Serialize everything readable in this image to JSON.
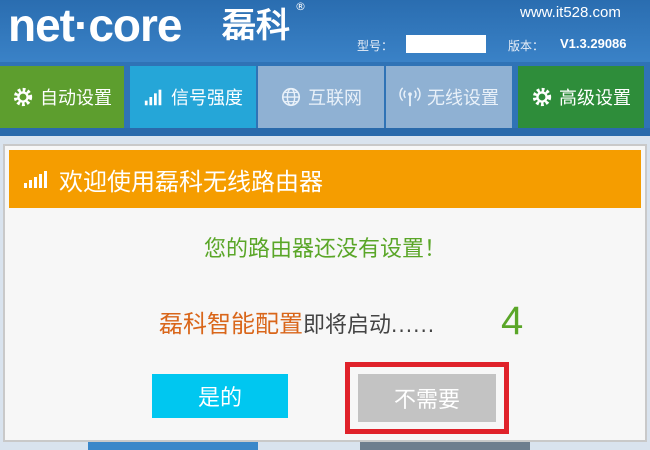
{
  "header": {
    "logo_text": "net·core",
    "logo_cn": "磊科",
    "registered_mark": "®",
    "watermark": "www.it528.com",
    "model_label": "型号：",
    "version_label": "版本：",
    "version_value": "V1.3.29086"
  },
  "nav": {
    "tabs": [
      {
        "label": "自动设置",
        "icon": "gear-icon",
        "color": "#5d9e2e"
      },
      {
        "label": "信号强度",
        "icon": "signal-bars-icon",
        "color": "#25a6d8"
      },
      {
        "label": "互联网",
        "icon": "globe-icon",
        "color": "#8fb1d3"
      },
      {
        "label": "无线设置",
        "icon": "wireless-icon",
        "color": "#8fb1d3"
      },
      {
        "label": "高级设置",
        "icon": "gear-icon",
        "color": "#2e8d3a"
      }
    ]
  },
  "dialog": {
    "title": "欢迎使用磊科无线路由器",
    "title_color": "#f59d00",
    "message": "您的路由器还没有设置！",
    "brand_text": "磊科智能配置",
    "rest_text": "即将启动",
    "dots": "......",
    "countdown": "4",
    "yes_label": "是的",
    "no_label": "不需要",
    "highlight_color": "#e0222a"
  }
}
